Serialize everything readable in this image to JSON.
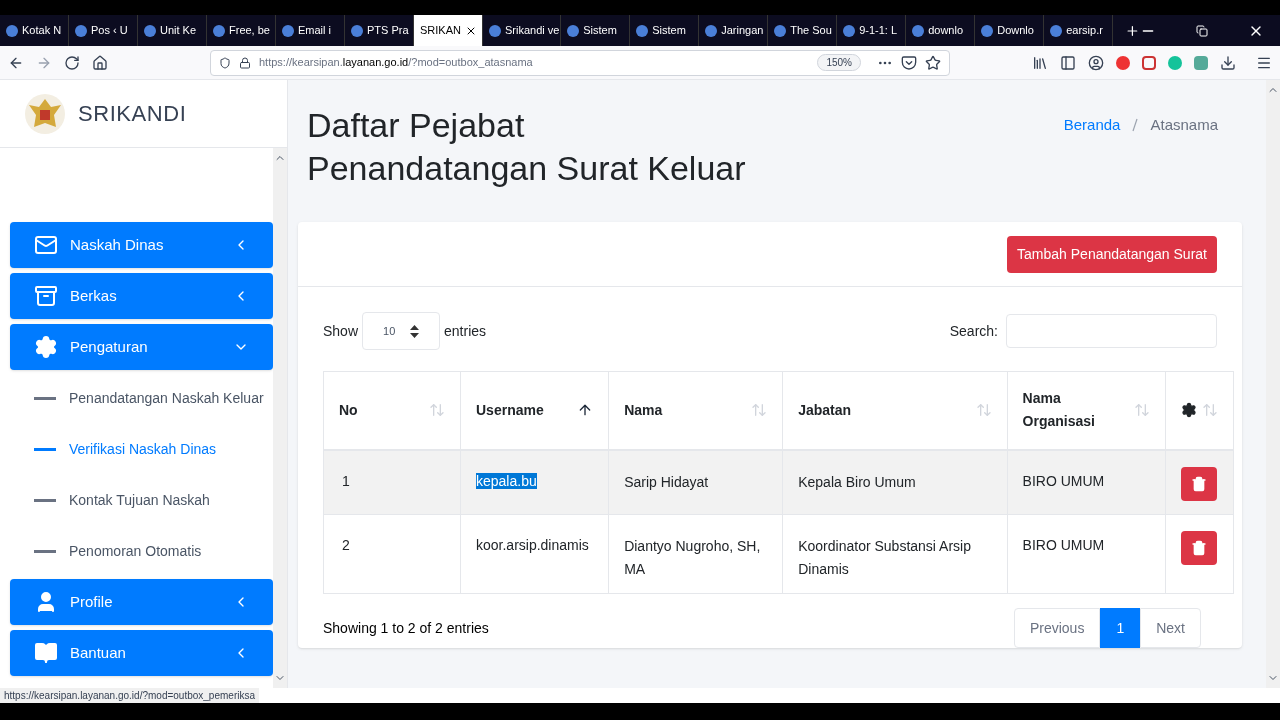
{
  "browser": {
    "tabs": [
      {
        "title": "Kotak N",
        "selected": false
      },
      {
        "title": "Pos ‹ U",
        "selected": false
      },
      {
        "title": "Unit Ke",
        "selected": false
      },
      {
        "title": "Free, be",
        "selected": false
      },
      {
        "title": "Email i",
        "selected": false
      },
      {
        "title": "PTS Pra",
        "selected": false
      },
      {
        "title": "SRIKAN",
        "selected": true
      },
      {
        "title": "Srikandi ve",
        "selected": false
      },
      {
        "title": "Sistem",
        "selected": false
      },
      {
        "title": "Sistem",
        "selected": false
      },
      {
        "title": "Jaringan",
        "selected": false
      },
      {
        "title": "The Sou",
        "selected": false
      },
      {
        "title": "9-1-1: L",
        "selected": false
      },
      {
        "title": "downlo",
        "selected": false
      },
      {
        "title": "Downlo",
        "selected": false
      },
      {
        "title": "earsip.r",
        "selected": false
      }
    ],
    "url_prefix": "https://kearsipan.",
    "url_domain": "layanan.go.id",
    "url_suffix": "/?mod=outbox_atasnama",
    "zoom": "150%",
    "status_url": "https://kearsipan.layanan.go.id/?mod=outbox_pemeriksa"
  },
  "sidebar": {
    "brand": "SRIKANDI",
    "items": [
      {
        "kind": "menu",
        "label": "Naskah Dinas",
        "expanded": false,
        "selected": false
      },
      {
        "kind": "menu",
        "label": "Berkas",
        "expanded": false,
        "selected": false
      },
      {
        "kind": "menu",
        "label": "Pengaturan",
        "expanded": true,
        "selected": false
      },
      {
        "kind": "submenu",
        "label": "Penandatangan Naskah Keluar",
        "selected": false
      },
      {
        "kind": "submenu",
        "label": "Verifikasi Naskah Dinas",
        "selected": true
      },
      {
        "kind": "submenu",
        "label": "Kontak Tujuan Naskah",
        "selected": false
      },
      {
        "kind": "submenu",
        "label": "Penomoran Otomatis",
        "selected": false
      },
      {
        "kind": "menu",
        "label": "Profile",
        "expanded": false,
        "selected": false
      },
      {
        "kind": "menu",
        "label": "Bantuan",
        "expanded": false,
        "selected": false
      }
    ]
  },
  "page": {
    "title_lines": [
      "Daftar Pejabat",
      "Penandatangan Surat Keluar"
    ],
    "breadcrumb": [
      {
        "label": "Beranda",
        "kind": "link"
      },
      {
        "label": "Atasnama",
        "kind": "current"
      }
    ],
    "add_button": "Tambah Penandatangan Surat",
    "show_label": "Show",
    "entries_value": "10",
    "entries_label": "entries",
    "search_label": "Search:",
    "table": {
      "columns": [
        {
          "kind": "text",
          "label": "No",
          "sorted": false
        },
        {
          "kind": "text",
          "label": "Username",
          "sorted": true
        },
        {
          "kind": "text",
          "label": "Nama",
          "sorted": false
        },
        {
          "kind": "text",
          "label": "Jabatan",
          "sorted": false
        },
        {
          "kind": "text",
          "label": "Nama Organisasi",
          "sorted": false
        },
        {
          "kind": "gear",
          "sorted": false
        }
      ],
      "rows": [
        {
          "no": "1",
          "username": "kepala.bu",
          "nama": "Sarip Hidayat",
          "jabatan": "Kepala Biro Umum",
          "organisasi": "BIRO UMUM",
          "hovered": true,
          "text_selected": true
        },
        {
          "no": "2",
          "username": "koor.arsip.dinamis",
          "nama": "Diantyo Nugroho, SH, MA",
          "jabatan": "Koordinator Substansi Arsip Dinamis",
          "organisasi": "BIRO UMUM",
          "hovered": false,
          "text_selected": false
        }
      ]
    },
    "info": "Showing 1 to 2 of 2 entries",
    "pagination": [
      {
        "label": "Previous",
        "selected": false
      },
      {
        "label": "1",
        "selected": true
      },
      {
        "label": "Next",
        "selected": false
      }
    ]
  }
}
